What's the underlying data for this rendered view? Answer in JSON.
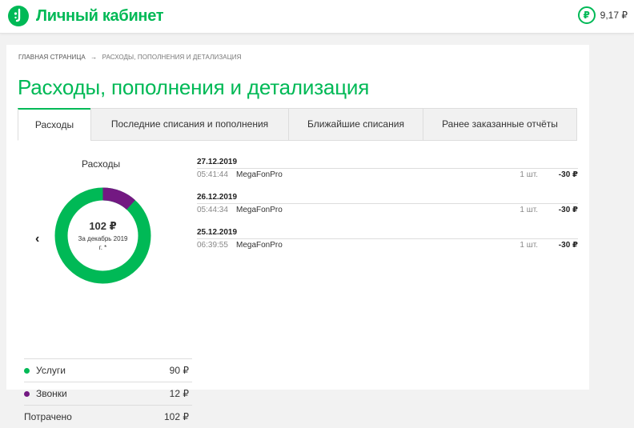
{
  "header": {
    "brand": "Личный кабинет",
    "balance_currency": "₽",
    "balance": "9,17 ₽"
  },
  "breadcrumb": {
    "home": "ГЛАВНАЯ СТРАНИЦА",
    "arrow": "→",
    "current": "РАСХОДЫ, ПОПОЛНЕНИЯ И ДЕТАЛИЗАЦИЯ"
  },
  "page_title": "Расходы, пополнения и детализация",
  "tabs": [
    {
      "label": "Расходы",
      "active": true
    },
    {
      "label": "Последние списания и пополнения",
      "active": false
    },
    {
      "label": "Ближайшие списания",
      "active": false
    },
    {
      "label": "Ранее заказанные отчёты",
      "active": false
    }
  ],
  "summary": {
    "title": "Расходы",
    "prev_arrow": "‹",
    "total": "102 ₽",
    "period": "За декабрь 2019 г. *",
    "colors": {
      "services": "#00b956",
      "calls": "#731982"
    },
    "shares": {
      "services": 90,
      "calls": 12
    },
    "legend": [
      {
        "label": "Услуги",
        "value": "90 ₽",
        "color": "#00b956"
      },
      {
        "label": "Звонки",
        "value": "12 ₽",
        "color": "#731982"
      }
    ],
    "total_label": "Потрачено",
    "total_value": "102 ₽"
  },
  "transactions": [
    {
      "date": "27.12.2019",
      "time": "05:41:44",
      "service": "MegaFonPro",
      "qty": "1 шт.",
      "amount": "-30 ₽"
    },
    {
      "date": "26.12.2019",
      "time": "05:44:34",
      "service": "MegaFonPro",
      "qty": "1 шт.",
      "amount": "-30 ₽"
    },
    {
      "date": "25.12.2019",
      "time": "06:39:55",
      "service": "MegaFonPro",
      "qty": "1 шт.",
      "amount": "-30 ₽"
    }
  ]
}
